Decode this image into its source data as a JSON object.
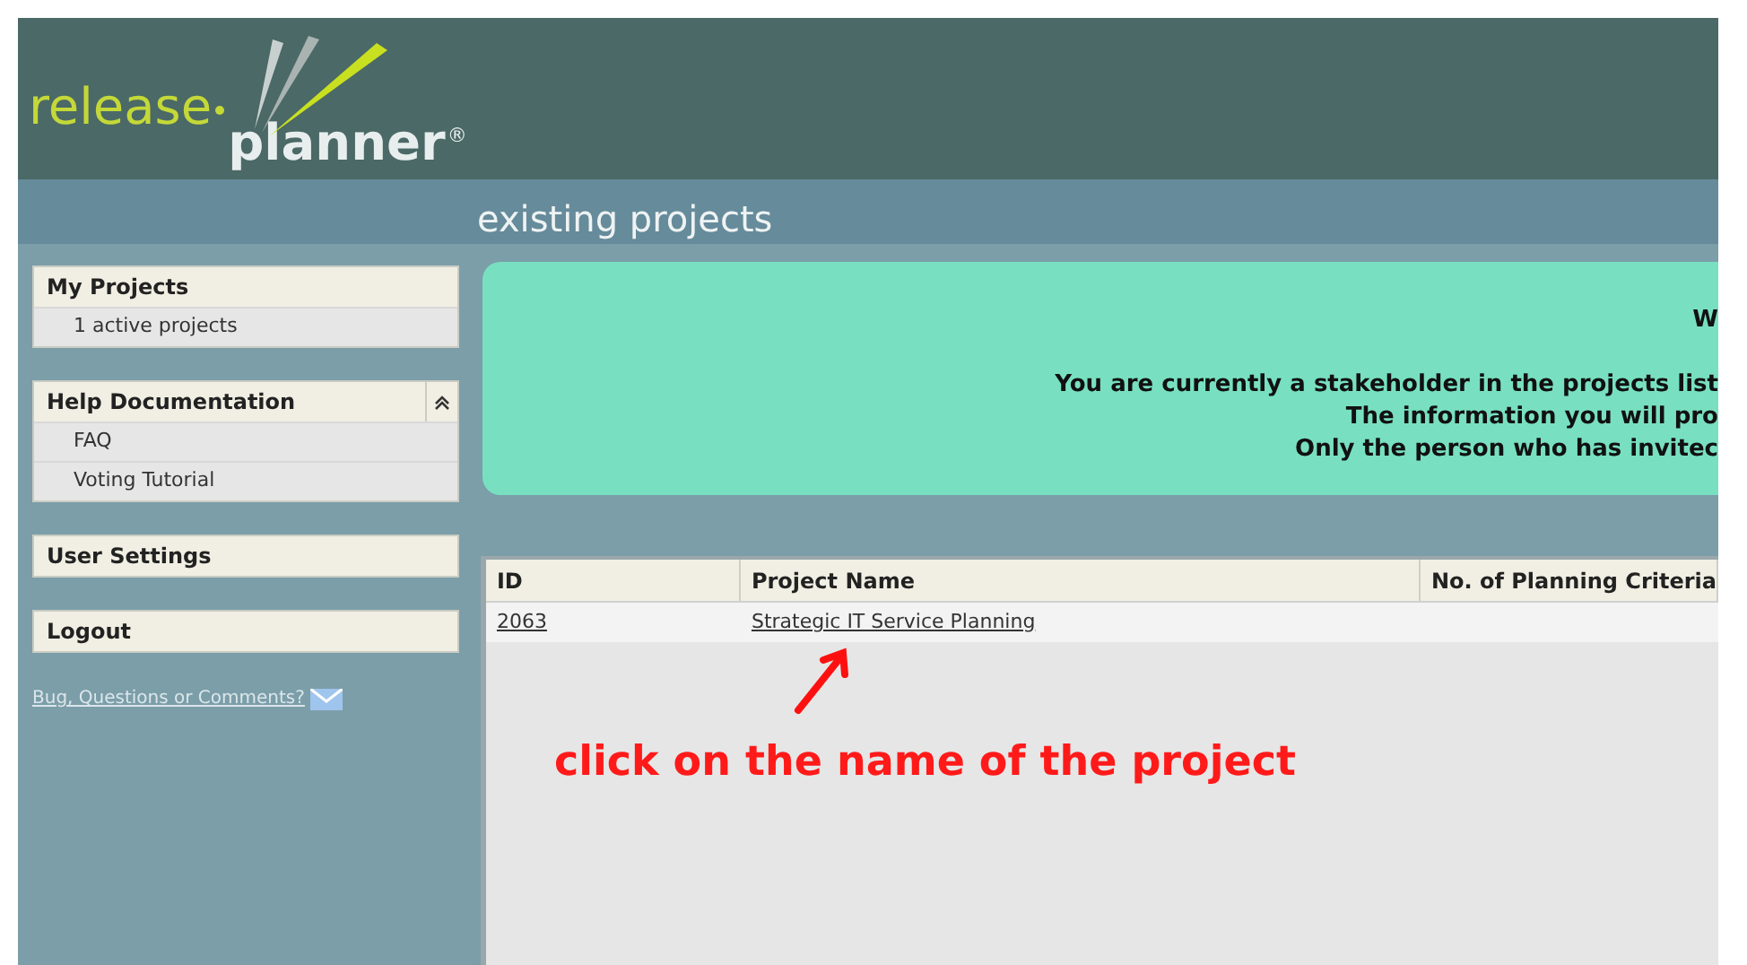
{
  "logo": {
    "word_1": "release",
    "word_2": "planner",
    "mark": "®"
  },
  "page_title": "existing projects",
  "sidebar": [
    {
      "title": "My Projects",
      "collapse": false,
      "items": [
        "1 active projects"
      ]
    },
    {
      "title": "Help Documentation",
      "collapse": true,
      "items": [
        "FAQ",
        "Voting Tutorial"
      ]
    },
    {
      "title": "User Settings",
      "collapse": false
    },
    {
      "title": "Logout",
      "collapse": false
    }
  ],
  "feedback_link": "Bug, Questions or Comments?",
  "notice": [
    "W",
    "You are currently a stakeholder in the projects list",
    "The information you will pro",
    "Only the person who has invitec"
  ],
  "table": {
    "columns": [
      "ID",
      "Project Name",
      "No. of Planning Criteria"
    ],
    "rows": [
      [
        "2063",
        "Strategic IT Service Planning",
        ""
      ]
    ]
  },
  "annotation": "click on the name of the project"
}
